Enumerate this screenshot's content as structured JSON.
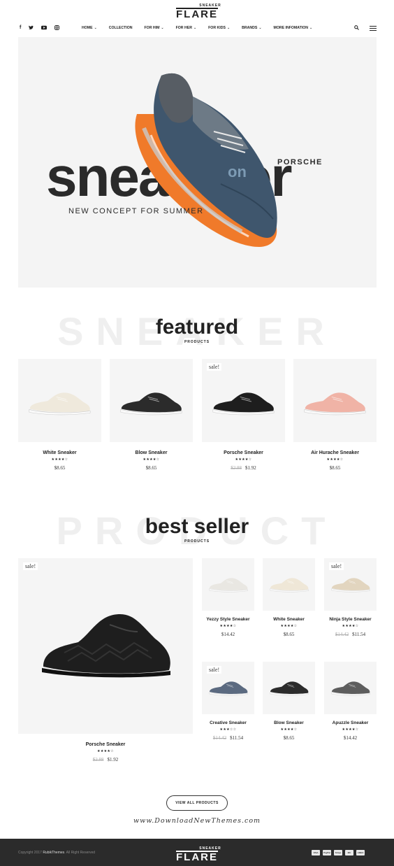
{
  "header": {
    "logo_small": "SNEAKER",
    "logo_main": "FLARE",
    "social": [
      "f",
      "t",
      "yt",
      "ig"
    ],
    "menu": [
      {
        "label": "HOME",
        "dropdown": true
      },
      {
        "label": "COLLECTION",
        "dropdown": false
      },
      {
        "label": "FOR HIM",
        "dropdown": true
      },
      {
        "label": "FOR HER",
        "dropdown": true
      },
      {
        "label": "FOR KIDS",
        "dropdown": true
      },
      {
        "label": "BRANDS",
        "dropdown": true
      },
      {
        "label": "MORE INFOMATION",
        "dropdown": true
      }
    ],
    "icons": [
      "search-icon",
      "menu-icon"
    ]
  },
  "hero": {
    "word_left": "snea",
    "word_right": "ker",
    "brand": "PORSCHE",
    "subtitle": "NEW CONCEPT FOR SUMMER"
  },
  "featured": {
    "bg_word": "SNEAKER",
    "title": "featured",
    "subtitle": "PRODUCTS",
    "items": [
      {
        "name": "White Sneaker",
        "rating": "★★★★☆",
        "price": "$8.65",
        "old_price": "",
        "sale": "",
        "shoe_color": "#efe9dc"
      },
      {
        "name": "Blow Sneaker",
        "rating": "★★★★☆",
        "price": "$8.65",
        "old_price": "",
        "sale": "",
        "shoe_color": "#2b2b2b"
      },
      {
        "name": "Porsche Sneaker",
        "rating": "★★★★☆",
        "price": "$1.92",
        "old_price": "$2.88",
        "sale": "sale!",
        "shoe_color": "#1e1e1e"
      },
      {
        "name": "Air Hurache Sneaker",
        "rating": "★★★★☆",
        "price": "$8.65",
        "old_price": "",
        "sale": "",
        "shoe_color": "#f0b3a6"
      }
    ]
  },
  "best_seller": {
    "bg_word": "PRODUCT",
    "title": "best seller",
    "subtitle": "PRODUCTS",
    "big": {
      "name": "Porsche Sneaker",
      "rating": "★★★★☆",
      "price": "$1.92",
      "old_price": "$2.88",
      "sale": "sale!"
    },
    "items": [
      {
        "name": "Yezzy Style Sneaker",
        "rating": "★★★★☆",
        "price": "$14.42",
        "old_price": "",
        "sale": "",
        "shoe_color": "#e9e7e2"
      },
      {
        "name": "White Sneaker",
        "rating": "★★★★☆",
        "price": "$8.65",
        "old_price": "",
        "sale": "",
        "shoe_color": "#efe7d7"
      },
      {
        "name": "Ninja Style Sneaker",
        "rating": "★★★★☆",
        "price": "$11.54",
        "old_price": "$14.42",
        "sale": "sale!",
        "shoe_color": "#e2d5bf"
      },
      {
        "name": "Creative Sneaker",
        "rating": "★★★☆☆",
        "price": "$11.54",
        "old_price": "$14.42",
        "sale": "sale!",
        "shoe_color": "#5b6a80"
      },
      {
        "name": "Blow Sneaker",
        "rating": "★★★★☆",
        "price": "$8.65",
        "old_price": "",
        "sale": "",
        "shoe_color": "#2b2b2b"
      },
      {
        "name": "Apuzzle Sneaker",
        "rating": "★★★★☆",
        "price": "$14.42",
        "old_price": "",
        "sale": "",
        "shoe_color": "#5d5d5d"
      }
    ]
  },
  "view_all_label": "VIEW ALL PRODUCTS",
  "watermark": "www.DownloadNewThemes.com",
  "footer": {
    "copyright_prefix": "Copyright 2017",
    "copyright_brand": "RubikThemes",
    "copyright_suffix": ". All Right Reserved",
    "logo_small": "SNEAKER",
    "logo_main": "FLARE",
    "payments": [
      "VISA",
      "PayPal",
      "Stripe",
      "MC",
      "AMEX"
    ]
  }
}
